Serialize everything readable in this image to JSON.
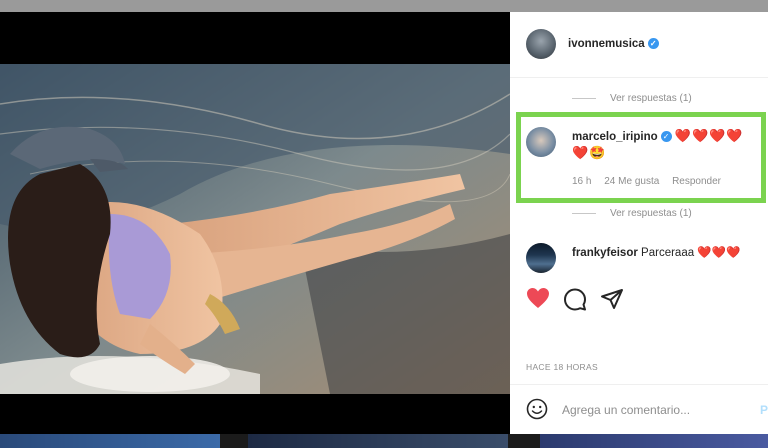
{
  "post": {
    "author": "ivonnemusica",
    "author_verified": true
  },
  "comments": {
    "view_replies_label": "Ver respuestas (1)",
    "highlighted": {
      "username": "marcelo_iripino",
      "verified": true,
      "text": "❤️❤️❤️❤️",
      "text_line2": "❤️🤩",
      "time": "16 h",
      "likes": "24 Me gusta",
      "reply_label": "Responder"
    },
    "second_view_replies_label": "Ver respuestas (1)",
    "next": {
      "username": "frankyfeisor",
      "text": "Parceraaa ❤️❤️❤️"
    }
  },
  "actions": {
    "like_icon": "heart-filled-icon",
    "comment_icon": "comment-icon",
    "share_icon": "share-icon",
    "like_color": "#ed4956"
  },
  "timestamp": "HACE 18 HORAS",
  "composer": {
    "emoji_icon": "emoji-icon",
    "placeholder": "Agrega un comentario...",
    "post_label": "P"
  },
  "colors": {
    "highlight_border": "#7bd34f",
    "verified": "#3897f0"
  }
}
